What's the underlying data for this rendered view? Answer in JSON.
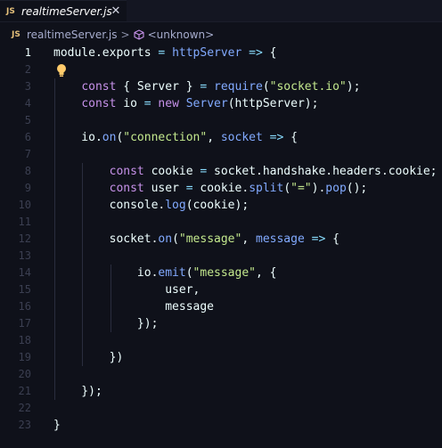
{
  "tab": {
    "badge": "JS",
    "title": "realtimeServer.js",
    "close_glyph": "✕"
  },
  "breadcrumb": {
    "badge": "JS",
    "file": "realtimeServer.js",
    "separator": ">",
    "symbol_icon": "cube-icon",
    "symbol": "<unknown>"
  },
  "editor": {
    "active_line": 1,
    "lines": [
      {
        "num": "1",
        "tokens": [
          [
            "plain",
            "module.exports "
          ],
          [
            "op",
            "="
          ],
          [
            "plain",
            " "
          ],
          [
            "fn",
            "httpServer"
          ],
          [
            "plain",
            " "
          ],
          [
            "op",
            "=>"
          ],
          [
            "plain",
            " {"
          ]
        ]
      },
      {
        "num": "2",
        "tokens": []
      },
      {
        "num": "3",
        "tokens": [
          [
            "plain",
            "    "
          ],
          [
            "kw",
            "const"
          ],
          [
            "plain",
            " { Server } "
          ],
          [
            "op",
            "="
          ],
          [
            "plain",
            " "
          ],
          [
            "fn",
            "require"
          ],
          [
            "plain",
            "("
          ],
          [
            "str",
            "\"socket.io\""
          ],
          [
            "plain",
            ");"
          ]
        ]
      },
      {
        "num": "4",
        "tokens": [
          [
            "plain",
            "    "
          ],
          [
            "kw",
            "const"
          ],
          [
            "plain",
            " io "
          ],
          [
            "op",
            "="
          ],
          [
            "plain",
            " "
          ],
          [
            "kw",
            "new"
          ],
          [
            "plain",
            " "
          ],
          [
            "fn",
            "Server"
          ],
          [
            "plain",
            "(httpServer);"
          ]
        ]
      },
      {
        "num": "5",
        "tokens": []
      },
      {
        "num": "6",
        "tokens": [
          [
            "plain",
            "    io."
          ],
          [
            "fn",
            "on"
          ],
          [
            "plain",
            "("
          ],
          [
            "str",
            "\"connection\""
          ],
          [
            "plain",
            ", "
          ],
          [
            "fn",
            "socket"
          ],
          [
            "plain",
            " "
          ],
          [
            "op",
            "=>"
          ],
          [
            "plain",
            " {"
          ]
        ]
      },
      {
        "num": "7",
        "tokens": []
      },
      {
        "num": "8",
        "tokens": [
          [
            "plain",
            "        "
          ],
          [
            "kw",
            "const"
          ],
          [
            "plain",
            " cookie "
          ],
          [
            "op",
            "="
          ],
          [
            "plain",
            " socket.handshake.headers.cookie;"
          ]
        ]
      },
      {
        "num": "9",
        "tokens": [
          [
            "plain",
            "        "
          ],
          [
            "kw",
            "const"
          ],
          [
            "plain",
            " user "
          ],
          [
            "op",
            "="
          ],
          [
            "plain",
            " cookie."
          ],
          [
            "fn",
            "split"
          ],
          [
            "plain",
            "("
          ],
          [
            "str",
            "\"=\""
          ],
          [
            "plain",
            ")."
          ],
          [
            "fn",
            "pop"
          ],
          [
            "plain",
            "();"
          ]
        ]
      },
      {
        "num": "10",
        "tokens": [
          [
            "plain",
            "        console."
          ],
          [
            "fn",
            "log"
          ],
          [
            "plain",
            "(cookie);"
          ]
        ]
      },
      {
        "num": "11",
        "tokens": []
      },
      {
        "num": "12",
        "tokens": [
          [
            "plain",
            "        socket."
          ],
          [
            "fn",
            "on"
          ],
          [
            "plain",
            "("
          ],
          [
            "str",
            "\"message\""
          ],
          [
            "plain",
            ", "
          ],
          [
            "fn",
            "message"
          ],
          [
            "plain",
            " "
          ],
          [
            "op",
            "=>"
          ],
          [
            "plain",
            " {"
          ]
        ]
      },
      {
        "num": "13",
        "tokens": []
      },
      {
        "num": "14",
        "tokens": [
          [
            "plain",
            "            io."
          ],
          [
            "fn",
            "emit"
          ],
          [
            "plain",
            "("
          ],
          [
            "str",
            "\"message\""
          ],
          [
            "plain",
            ", {"
          ]
        ]
      },
      {
        "num": "15",
        "tokens": [
          [
            "plain",
            "                user,"
          ]
        ]
      },
      {
        "num": "16",
        "tokens": [
          [
            "plain",
            "                message"
          ]
        ]
      },
      {
        "num": "17",
        "tokens": [
          [
            "plain",
            "            });"
          ]
        ]
      },
      {
        "num": "18",
        "tokens": []
      },
      {
        "num": "19",
        "tokens": [
          [
            "plain",
            "        })"
          ]
        ]
      },
      {
        "num": "20",
        "tokens": []
      },
      {
        "num": "21",
        "tokens": [
          [
            "plain",
            "    });"
          ]
        ]
      },
      {
        "num": "22",
        "tokens": []
      },
      {
        "num": "23",
        "tokens": [
          [
            "plain",
            "}"
          ]
        ]
      }
    ]
  },
  "colors": {
    "background": "#0f111a",
    "keyword": "#c792ea",
    "function": "#82aaff",
    "string": "#c3e88d",
    "operator": "#89ddff",
    "text": "#eeffff",
    "js_badge": "#e5c07b",
    "lightbulb": "#ffcb6b"
  },
  "lightbulb_icon": "lightbulb-icon"
}
